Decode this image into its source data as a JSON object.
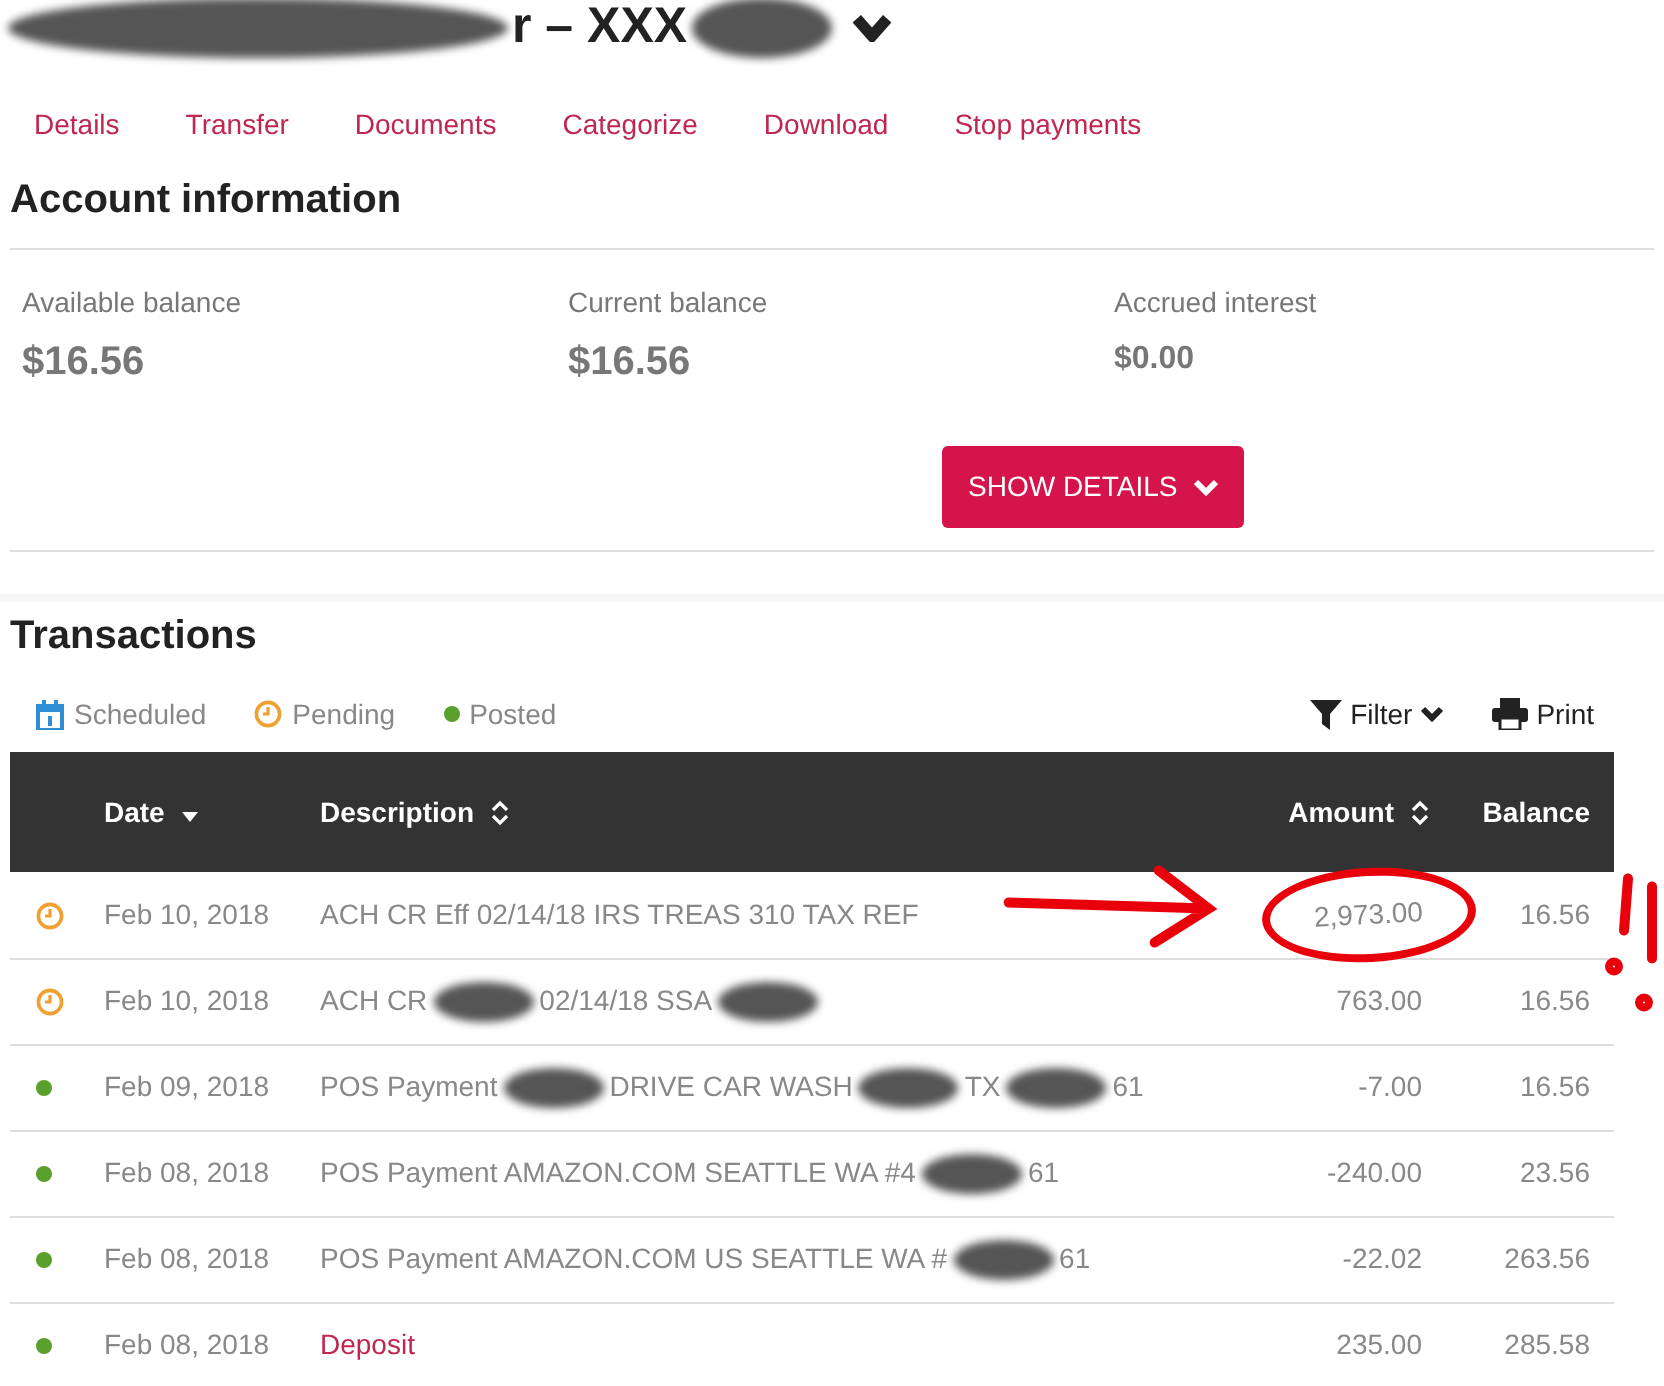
{
  "account_title": [
    {
      "kind": "redacted"
    },
    {
      "kind": "text",
      "text": "r – XXX"
    },
    {
      "kind": "redacted"
    }
  ],
  "tabs": [
    {
      "label": "Details"
    },
    {
      "label": "Transfer"
    },
    {
      "label": "Documents"
    },
    {
      "label": "Categorize"
    },
    {
      "label": "Download"
    },
    {
      "label": "Stop payments"
    }
  ],
  "account_information": {
    "title": "Account information",
    "balances": [
      {
        "label": "Available balance",
        "value": "$16.56",
        "kind": "large"
      },
      {
        "label": "Current balance",
        "value": "$16.56",
        "kind": "large"
      },
      {
        "label": "Accrued interest",
        "value": "$0.00",
        "kind": "small"
      }
    ],
    "show_details_button": "SHOW DETAILS"
  },
  "transactions": {
    "title": "Transactions",
    "legend": [
      {
        "kind": "scheduled",
        "label": "Scheduled"
      },
      {
        "kind": "pending",
        "label": "Pending"
      },
      {
        "kind": "posted",
        "label": "Posted"
      }
    ],
    "filter_button": "Filter",
    "print_button": "Print",
    "columns": [
      {
        "label": "Date",
        "kind": "sorted"
      },
      {
        "label": "Description",
        "kind": "sortable"
      },
      {
        "label": "Amount",
        "kind": "sortable"
      },
      {
        "label": "Balance",
        "kind": "plain"
      }
    ],
    "rows": [
      {
        "kind": "pending",
        "circled": true,
        "date": "Feb 10, 2018",
        "description": [
          {
            "kind": "text",
            "text": "ACH CR Eff 02/14/18 IRS TREAS 310 TAX REF"
          }
        ],
        "amount": "2,973.00",
        "balance": "16.56"
      },
      {
        "kind": "pending",
        "circled": false,
        "date": "Feb 10, 2018",
        "description": [
          {
            "kind": "text",
            "text": "ACH CR"
          },
          {
            "kind": "redacted"
          },
          {
            "kind": "text",
            "text": "02/14/18 SSA"
          },
          {
            "kind": "redacted"
          }
        ],
        "amount": "763.00",
        "balance": "16.56"
      },
      {
        "kind": "posted",
        "circled": false,
        "date": "Feb 09, 2018",
        "description": [
          {
            "kind": "text",
            "text": "POS Payment"
          },
          {
            "kind": "redacted"
          },
          {
            "kind": "text",
            "text": "DRIVE CAR WASH"
          },
          {
            "kind": "redacted"
          },
          {
            "kind": "text",
            "text": "TX"
          },
          {
            "kind": "redacted"
          },
          {
            "kind": "text",
            "text": "61"
          }
        ],
        "amount": "-7.00",
        "balance": "16.56"
      },
      {
        "kind": "posted",
        "circled": false,
        "date": "Feb 08, 2018",
        "description": [
          {
            "kind": "text",
            "text": "POS Payment AMAZON.COM SEATTLE WA #4"
          },
          {
            "kind": "redacted"
          },
          {
            "kind": "text",
            "text": "61"
          }
        ],
        "amount": "-240.00",
        "balance": "23.56"
      },
      {
        "kind": "posted",
        "circled": false,
        "date": "Feb 08, 2018",
        "description": [
          {
            "kind": "text",
            "text": "POS Payment AMAZON.COM US SEATTLE WA #"
          },
          {
            "kind": "redacted"
          },
          {
            "kind": "text",
            "text": "61"
          }
        ],
        "amount": "-22.02",
        "balance": "263.56"
      },
      {
        "kind": "posted",
        "circled": false,
        "date": "Feb 08, 2018",
        "description": [
          {
            "kind": "link",
            "text": "Deposit"
          }
        ],
        "amount": "235.00",
        "balance": "285.58"
      }
    ]
  }
}
